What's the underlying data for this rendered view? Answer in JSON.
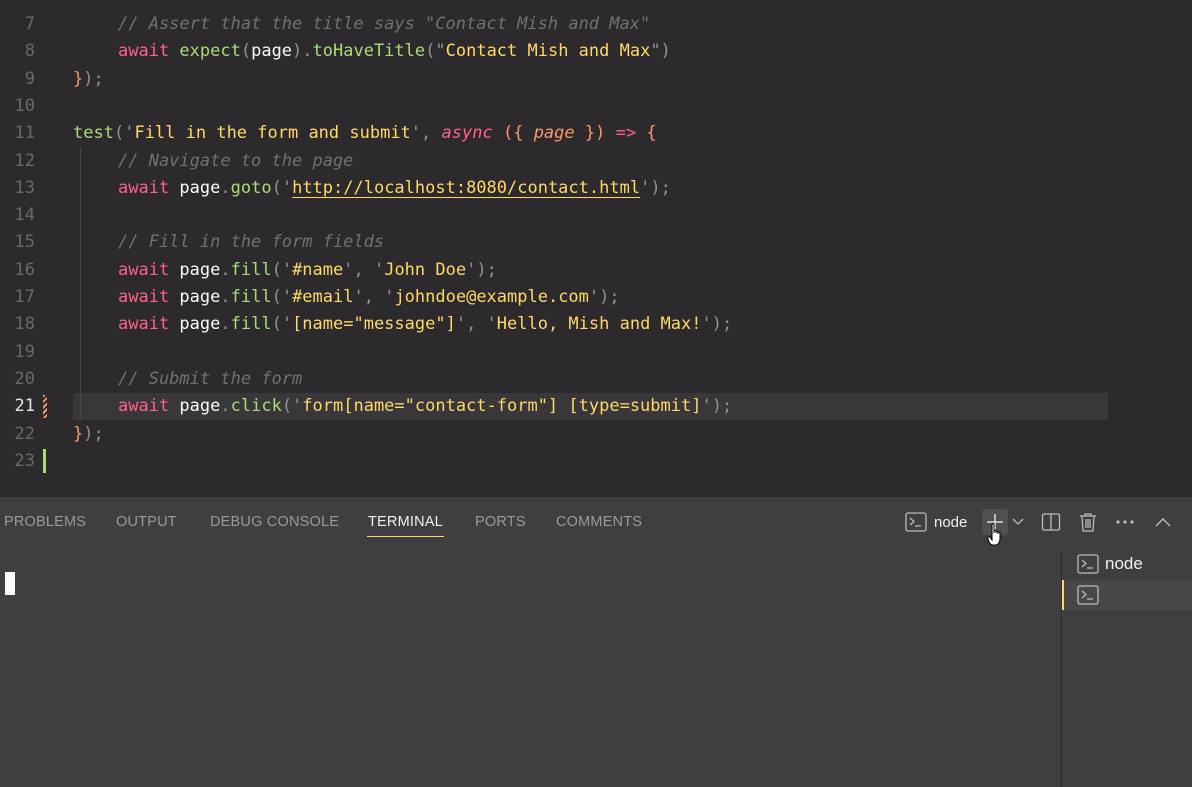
{
  "editor": {
    "lines": [
      {
        "n": "7",
        "indent": true,
        "parts": [
          [
            "cm",
            "// Assert that the title says \"Contact Mish and Max\""
          ]
        ]
      },
      {
        "n": "8",
        "indent": true,
        "parts": [
          [
            "kw",
            "await "
          ],
          [
            "fn",
            "expect"
          ],
          [
            "pun",
            "("
          ],
          [
            "var",
            "page"
          ],
          [
            "pun",
            ")."
          ],
          [
            "fn",
            "toHaveTitle"
          ],
          [
            "pun",
            "("
          ],
          [
            "pun",
            "\""
          ],
          [
            "str",
            "Contact Mish and Max"
          ],
          [
            "pun",
            "\""
          ],
          [
            "pun",
            ")"
          ]
        ]
      },
      {
        "n": "9",
        "indent": false,
        "parts": [
          [
            "brk",
            "}"
          ],
          [
            "pun",
            ");"
          ]
        ]
      },
      {
        "n": "10",
        "indent": false,
        "parts": []
      },
      {
        "n": "11",
        "indent": false,
        "parts": [
          [
            "fn",
            "test"
          ],
          [
            "pun",
            "("
          ],
          [
            "pun",
            "'"
          ],
          [
            "str",
            "Fill in the form and submit"
          ],
          [
            "pun",
            "'"
          ],
          [
            "pun",
            ", "
          ],
          [
            "async",
            "async"
          ],
          [
            "pun",
            " "
          ],
          [
            "brk",
            "({ "
          ],
          [
            "it",
            "page"
          ],
          [
            "brk",
            " })"
          ],
          [
            "pun",
            " "
          ],
          [
            "kw",
            "=>"
          ],
          [
            "pun",
            " "
          ],
          [
            "brk",
            "{"
          ]
        ]
      },
      {
        "n": "12",
        "indent": true,
        "parts": [
          [
            "cm",
            "// Navigate to the page"
          ]
        ]
      },
      {
        "n": "13",
        "indent": true,
        "parts": [
          [
            "kw",
            "await "
          ],
          [
            "var",
            "page"
          ],
          [
            "pun",
            "."
          ],
          [
            "fn",
            "goto"
          ],
          [
            "pun",
            "("
          ],
          [
            "pun",
            "'"
          ],
          [
            "str u",
            "http://localhost:8080/contact.html"
          ],
          [
            "pun",
            "'"
          ],
          [
            "pun",
            ");"
          ]
        ]
      },
      {
        "n": "14",
        "indent": true,
        "parts": []
      },
      {
        "n": "15",
        "indent": true,
        "parts": [
          [
            "cm",
            "// Fill in the form fields"
          ]
        ]
      },
      {
        "n": "16",
        "indent": true,
        "parts": [
          [
            "kw",
            "await "
          ],
          [
            "var",
            "page"
          ],
          [
            "pun",
            "."
          ],
          [
            "fn",
            "fill"
          ],
          [
            "pun",
            "('"
          ],
          [
            "str",
            "#name"
          ],
          [
            "pun",
            "', '"
          ],
          [
            "str",
            "John Doe"
          ],
          [
            "pun",
            "');"
          ]
        ]
      },
      {
        "n": "17",
        "indent": true,
        "parts": [
          [
            "kw",
            "await "
          ],
          [
            "var",
            "page"
          ],
          [
            "pun",
            "."
          ],
          [
            "fn",
            "fill"
          ],
          [
            "pun",
            "('"
          ],
          [
            "str",
            "#email"
          ],
          [
            "pun",
            "', '"
          ],
          [
            "str",
            "johndoe@example.com"
          ],
          [
            "pun",
            "');"
          ]
        ]
      },
      {
        "n": "18",
        "indent": true,
        "parts": [
          [
            "kw",
            "await "
          ],
          [
            "var",
            "page"
          ],
          [
            "pun",
            "."
          ],
          [
            "fn",
            "fill"
          ],
          [
            "pun",
            "('"
          ],
          [
            "str",
            "[name=\"message\"]"
          ],
          [
            "pun",
            "', '"
          ],
          [
            "str",
            "Hello, Mish and Max!"
          ],
          [
            "pun",
            "');"
          ]
        ]
      },
      {
        "n": "19",
        "indent": true,
        "parts": []
      },
      {
        "n": "20",
        "indent": true,
        "parts": [
          [
            "cm",
            "// Submit the form"
          ]
        ]
      },
      {
        "n": "21",
        "indent": true,
        "active": true,
        "parts": [
          [
            "kw",
            "await "
          ],
          [
            "var",
            "page"
          ],
          [
            "pun",
            "."
          ],
          [
            "fn",
            "click"
          ],
          [
            "pun",
            "('"
          ],
          [
            "str",
            "form[name=\"contact-form\"] [type=submit]"
          ],
          [
            "pun",
            "');"
          ]
        ]
      },
      {
        "n": "22",
        "indent": false,
        "parts": [
          [
            "brk",
            "}"
          ],
          [
            "pun",
            ");"
          ]
        ]
      },
      {
        "n": "23",
        "indent": false,
        "parts": []
      }
    ]
  },
  "panel": {
    "tabs": [
      {
        "label": "PROBLEMS",
        "active": false
      },
      {
        "label": "OUTPUT",
        "active": false
      },
      {
        "label": "DEBUG CONSOLE",
        "active": false
      },
      {
        "label": "TERMINAL",
        "active": true
      },
      {
        "label": "PORTS",
        "active": false
      },
      {
        "label": "COMMENTS",
        "active": false
      }
    ],
    "terminal_name": "node",
    "terminal_list": [
      {
        "label": "node",
        "selected": false
      },
      {
        "label": "",
        "selected": true
      }
    ]
  },
  "colors": {
    "accent": "#ffd866",
    "added_gutter": "#a9dc76",
    "modified_gutter": "#fc9867"
  }
}
